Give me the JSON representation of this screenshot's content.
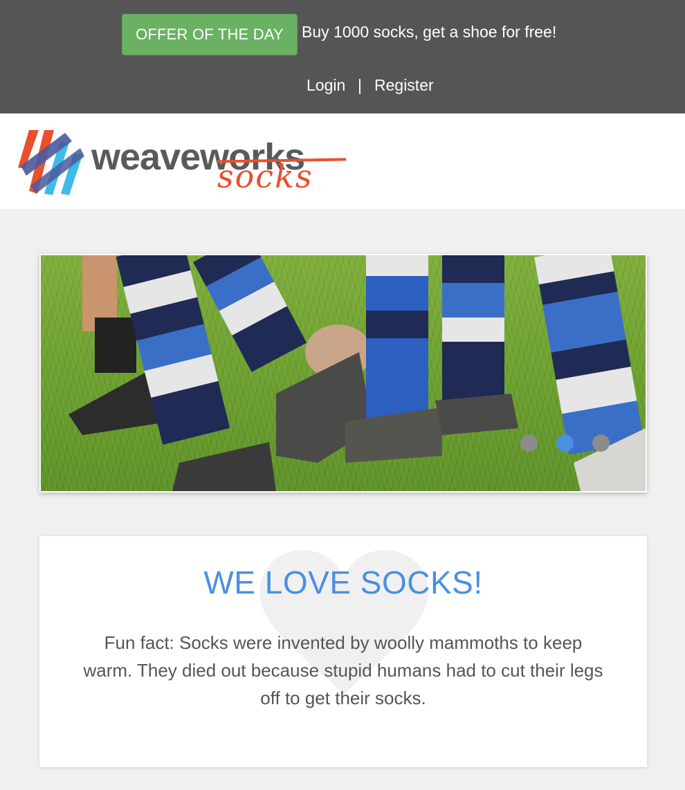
{
  "topbar": {
    "offer_button": "OFFER OF THE DAY",
    "offer_text": "Buy 1000 socks, get a shoe for free!",
    "login": "Login",
    "separator": "|",
    "register": "Register"
  },
  "logo": {
    "word": "weaveworks",
    "sub": "socks"
  },
  "carousel": {
    "slides": 3,
    "active_index": 1
  },
  "card": {
    "title": "WE LOVE SOCKS!",
    "text": "Fun fact: Socks were invented by woolly mammoths to keep warm. They died out because stupid humans had to cut their legs off to get their socks."
  },
  "colors": {
    "topbar_bg": "#555555",
    "offer_green": "#6ab164",
    "accent_blue": "#4a90e2",
    "logo_orange": "#e8502e",
    "page_bg": "#f0f0f0"
  }
}
